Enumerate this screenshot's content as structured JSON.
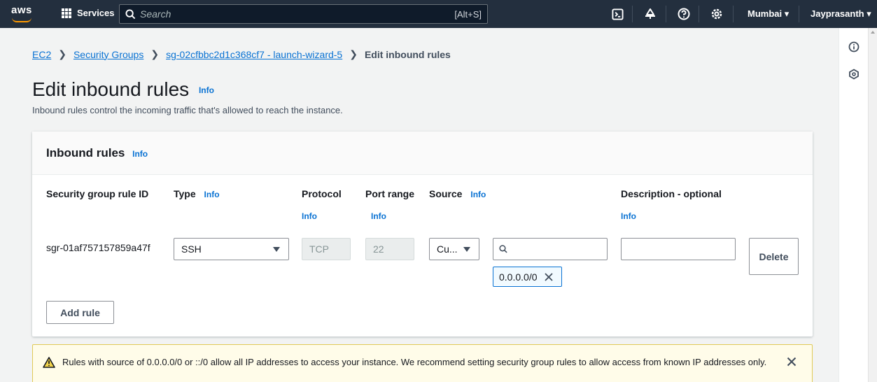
{
  "topnav": {
    "logo": "aws",
    "services_label": "Services",
    "search_placeholder": "Search",
    "search_shortcut": "[Alt+S]",
    "icons": [
      "cloudshell-icon",
      "bell-icon",
      "help-icon",
      "gear-icon"
    ],
    "region": "Mumbai ▾",
    "user": "Jayprasanth ▾"
  },
  "breadcrumb": {
    "items": [
      "EC2",
      "Security Groups",
      "sg-02cfbbc2d1c368cf7 - launch-wizard-5"
    ],
    "current": "Edit inbound rules"
  },
  "page": {
    "title": "Edit inbound rules",
    "title_info": "Info",
    "description": "Inbound rules control the incoming traffic that's allowed to reach the instance."
  },
  "panel": {
    "title": "Inbound rules",
    "title_info": "Info",
    "columns": {
      "rule_id": "Security group rule ID",
      "type": "Type",
      "protocol": "Protocol",
      "port_range": "Port range",
      "source": "Source",
      "description": "Description - optional"
    },
    "info_label": "Info",
    "rule": {
      "id": "sgr-01af757157859a47f",
      "type": "SSH",
      "protocol": "TCP",
      "port_range": "22",
      "source_type": "Cu...",
      "source_search": "",
      "source_token": "0.0.0.0/0",
      "description": ""
    },
    "delete_label": "Delete",
    "add_rule_label": "Add rule"
  },
  "alert": {
    "message": "Rules with source of 0.0.0.0/0 or ::/0 allow all IP addresses to access your instance. We recommend setting security group rules to allow access from known IP addresses only."
  },
  "colors": {
    "nav_bg": "#232f3e",
    "link": "#0972d3",
    "brand": "#ff9900",
    "warning_bg": "#fffce9"
  }
}
